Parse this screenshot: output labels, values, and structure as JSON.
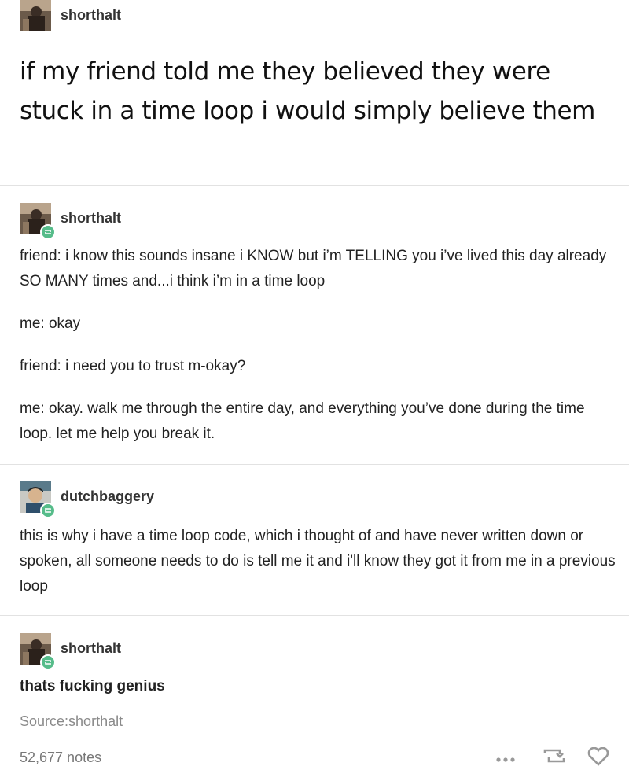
{
  "posts": [
    {
      "username": "shorthalt",
      "text": "if my friend told me they believed they were stuck in a time loop i would simply believe them"
    },
    {
      "username": "shorthalt",
      "paragraphs": [
        "friend: i know this sounds insane i KNOW but i’m TELLING you i’ve lived this day already SO MANY times and...i think i’m in a time loop",
        "me: okay",
        "friend: i need you to trust m-okay?",
        "me: okay. walk me through the entire day, and everything you’ve done during the time loop. let me help you break it."
      ]
    },
    {
      "username": "dutchbaggery",
      "text": "this is why i have a time loop code, which i thought of and have never written down or spoken, all someone needs to do is tell me it and i'll know they got it from me in a previous loop"
    },
    {
      "username": "shorthalt",
      "text": "thats fucking genius"
    }
  ],
  "footer": {
    "source_label": "Source:",
    "source_name": "shorthalt",
    "notes": "52,677 notes",
    "icons": [
      "more-icon",
      "reblog-icon",
      "like-icon"
    ]
  },
  "colors": {
    "reblog_badge": "#56bc8a",
    "divider": "#e2e2e2",
    "muted_text": "#8a8a8a"
  }
}
